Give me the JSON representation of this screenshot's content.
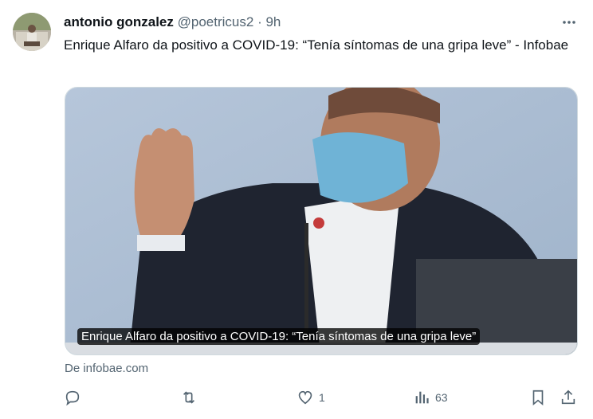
{
  "author": {
    "name": "antonio gonzalez",
    "handle": "@poetricus2",
    "separator": "·",
    "time": "9h"
  },
  "tweet": {
    "text": "Enrique Alfaro da positivo a COVID-19: “Tenía síntomas de una gripa leve” - Infobae"
  },
  "card": {
    "caption": "Enrique Alfaro da positivo a COVID-19: “Tenía síntomas de una gripa leve”",
    "source": "De infobae.com"
  },
  "actions": {
    "reply_count": "",
    "retweet_count": "",
    "like_count": "1",
    "view_count": "63"
  },
  "colors": {
    "text": "#0f1419",
    "secondary": "#536471",
    "border": "#cfd9de"
  },
  "icons": [
    "avatar",
    "more-icon",
    "reply-icon",
    "retweet-icon",
    "like-icon",
    "views-icon",
    "bookmark-icon",
    "share-icon"
  ]
}
